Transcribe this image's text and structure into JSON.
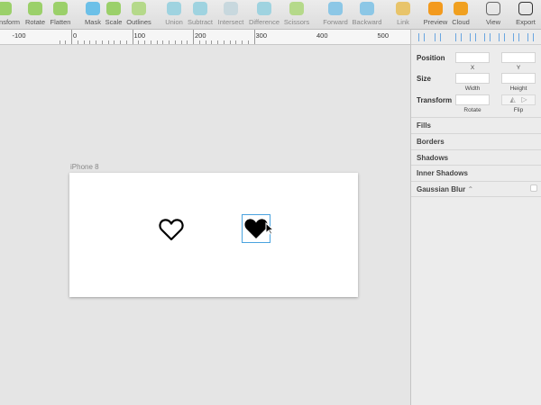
{
  "toolbar": {
    "items": [
      {
        "label": "Transform",
        "icon": "transform-icon",
        "color": "#9bd06a"
      },
      {
        "label": "Rotate",
        "icon": "rotate-icon",
        "color": "#9bd06a"
      },
      {
        "label": "Flatten",
        "icon": "flatten-icon",
        "color": "#9bd06a"
      },
      {
        "label": "Mask",
        "icon": "mask-icon",
        "color": "#6cc0e8"
      },
      {
        "label": "Scale",
        "icon": "scale-icon",
        "color": "#9bd06a"
      },
      {
        "label": "Outlines",
        "icon": "outlines-icon",
        "color": "#b5d98a"
      },
      {
        "label": "Union",
        "icon": "union-icon",
        "color": "#9fd3e0"
      },
      {
        "label": "Subtract",
        "icon": "subtract-icon",
        "color": "#9fd3e0"
      },
      {
        "label": "Intersect",
        "icon": "intersect-icon",
        "color": "#c8d8de"
      },
      {
        "label": "Difference",
        "icon": "difference-icon",
        "color": "#9fd3e0"
      },
      {
        "label": "Scissors",
        "icon": "scissors-icon",
        "color": "#b5d98a"
      },
      {
        "label": "Forward",
        "icon": "forward-icon",
        "color": "#8cc7e6"
      },
      {
        "label": "Backward",
        "icon": "backward-icon",
        "color": "#8cc7e6"
      },
      {
        "label": "Link",
        "icon": "link-icon",
        "color": "#e8c46a"
      },
      {
        "label": "Preview",
        "icon": "preview-icon",
        "color": "#f39a1e"
      },
      {
        "label": "Cloud",
        "icon": "cloud-icon",
        "color": "#f0a020"
      },
      {
        "label": "View",
        "icon": "view-icon",
        "color": "#666666"
      },
      {
        "label": "Export",
        "icon": "export-icon",
        "color": "#333333"
      }
    ]
  },
  "ruler": {
    "labels": [
      "-100",
      "0",
      "100",
      "200",
      "300",
      "400",
      "500"
    ]
  },
  "canvas": {
    "artboard_label": "iPhone 8",
    "selection_color": "#4aa3df"
  },
  "inspector": {
    "position_label": "Position",
    "x_label": "X",
    "y_label": "Y",
    "size_label": "Size",
    "width_label": "Width",
    "height_label": "Height",
    "transform_label": "Transform",
    "rotate_label": "Rotate",
    "flip_label": "Flip",
    "sections": [
      "Fills",
      "Borders",
      "Shadows",
      "Inner Shadows",
      "Gaussian Blur"
    ]
  }
}
